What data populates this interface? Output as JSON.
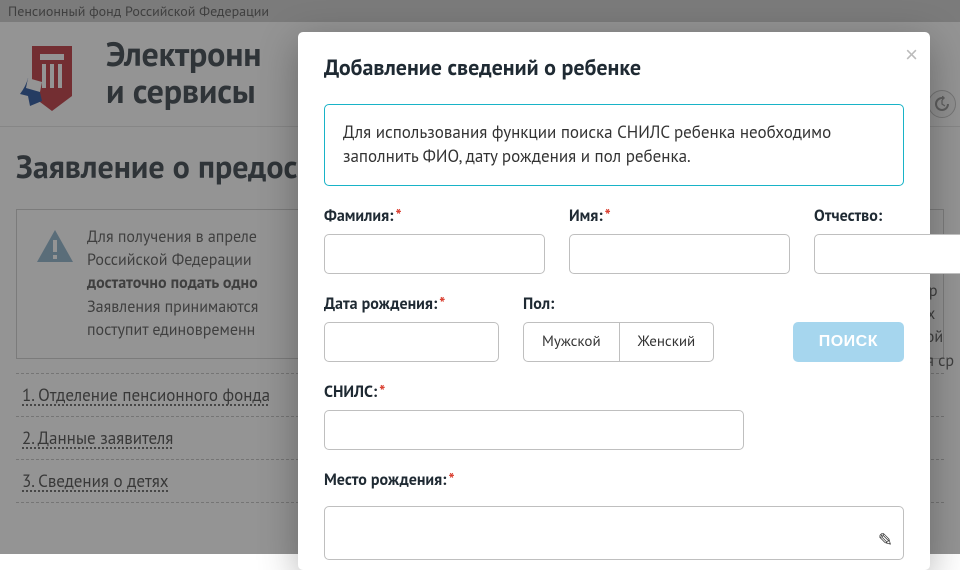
{
  "top": {
    "ministry": "Пенсионный фонд Российской Федерации"
  },
  "brand": {
    "line1": "Электронн",
    "line2": "и сервисы"
  },
  "page": {
    "title": "Заявление о предос"
  },
  "info": {
    "line1": "Для получения в апреле",
    "line2": "Российской Федерации",
    "line3_bold": "достаточно подать одно",
    "line4": "Заявления принимаются",
    "line5": "поступит единовременн",
    "right1": "Пр",
    "right2": "их",
    "right3": "кой",
    "right4": "ая ср"
  },
  "accordion": {
    "item1": "1. Отделение пенсионного фонда",
    "item2": "2. Данные заявителя",
    "item3": "3. Сведения о детях"
  },
  "modal": {
    "title": "Добавление сведений о ребенке",
    "hint": "Для использования функции поиска СНИЛС ребенка необходимо заполнить ФИО, дату рождения и пол ребенка.",
    "labels": {
      "surname": "Фамилия:",
      "name": "Имя:",
      "patronymic": "Отчество:",
      "dob": "Дата рождения:",
      "gender": "Пол:",
      "snils": "СНИЛС:",
      "birthplace": "Место рождения:"
    },
    "gender": {
      "male": "Мужской",
      "female": "Женский"
    },
    "search_button": "ПОИСК"
  }
}
